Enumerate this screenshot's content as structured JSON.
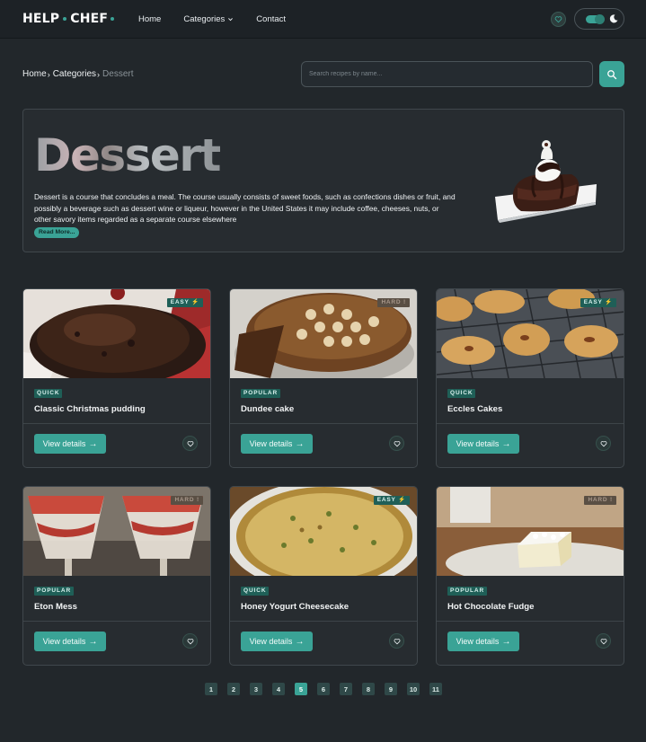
{
  "brand": {
    "part1": "HELP",
    "part2": "CHEF",
    "accent": "#3aa396"
  },
  "nav": {
    "home": "Home",
    "categories": "Categories",
    "contact": "Contact",
    "favorites_icon": "heart-icon",
    "theme_toggle": {
      "state": "dark",
      "icon": "moon-icon"
    }
  },
  "breadcrumb": {
    "home": "Home",
    "categories": "Categories",
    "current": "Dessert"
  },
  "search": {
    "placeholder": "Search recipes by name...",
    "value": "",
    "icon": "search-icon"
  },
  "hero": {
    "title": "Dessert",
    "description": "Dessert is a course that concludes a meal. The course usually consists of sweet foods, such as confections dishes or fruit, and possibly a beverage such as dessert wine or liqueur, however in the United States it may include coffee, cheeses, nuts, or other savory items regarded as a separate course elsewhere",
    "read_more": "Read More..."
  },
  "cards": [
    {
      "title": "Classic Christmas pudding",
      "badge": "QUICK",
      "difficulty": "EASY",
      "button": "View details"
    },
    {
      "title": "Dundee cake",
      "badge": "POPULAR",
      "difficulty": "HARD",
      "button": "View details"
    },
    {
      "title": "Eccles Cakes",
      "badge": "QUICK",
      "difficulty": "EASY",
      "button": "View details"
    },
    {
      "title": "Eton Mess",
      "badge": "POPULAR",
      "difficulty": "HARD",
      "button": "View details"
    },
    {
      "title": "Honey Yogurt Cheesecake",
      "badge": "QUICK",
      "difficulty": "EASY",
      "button": "View details"
    },
    {
      "title": "Hot Chocolate Fudge",
      "badge": "POPULAR",
      "difficulty": "HARD",
      "button": "View details"
    }
  ],
  "pagination": {
    "pages": [
      "1",
      "2",
      "3",
      "4",
      "5",
      "6",
      "7",
      "8",
      "9",
      "10",
      "11"
    ],
    "current": "5"
  }
}
